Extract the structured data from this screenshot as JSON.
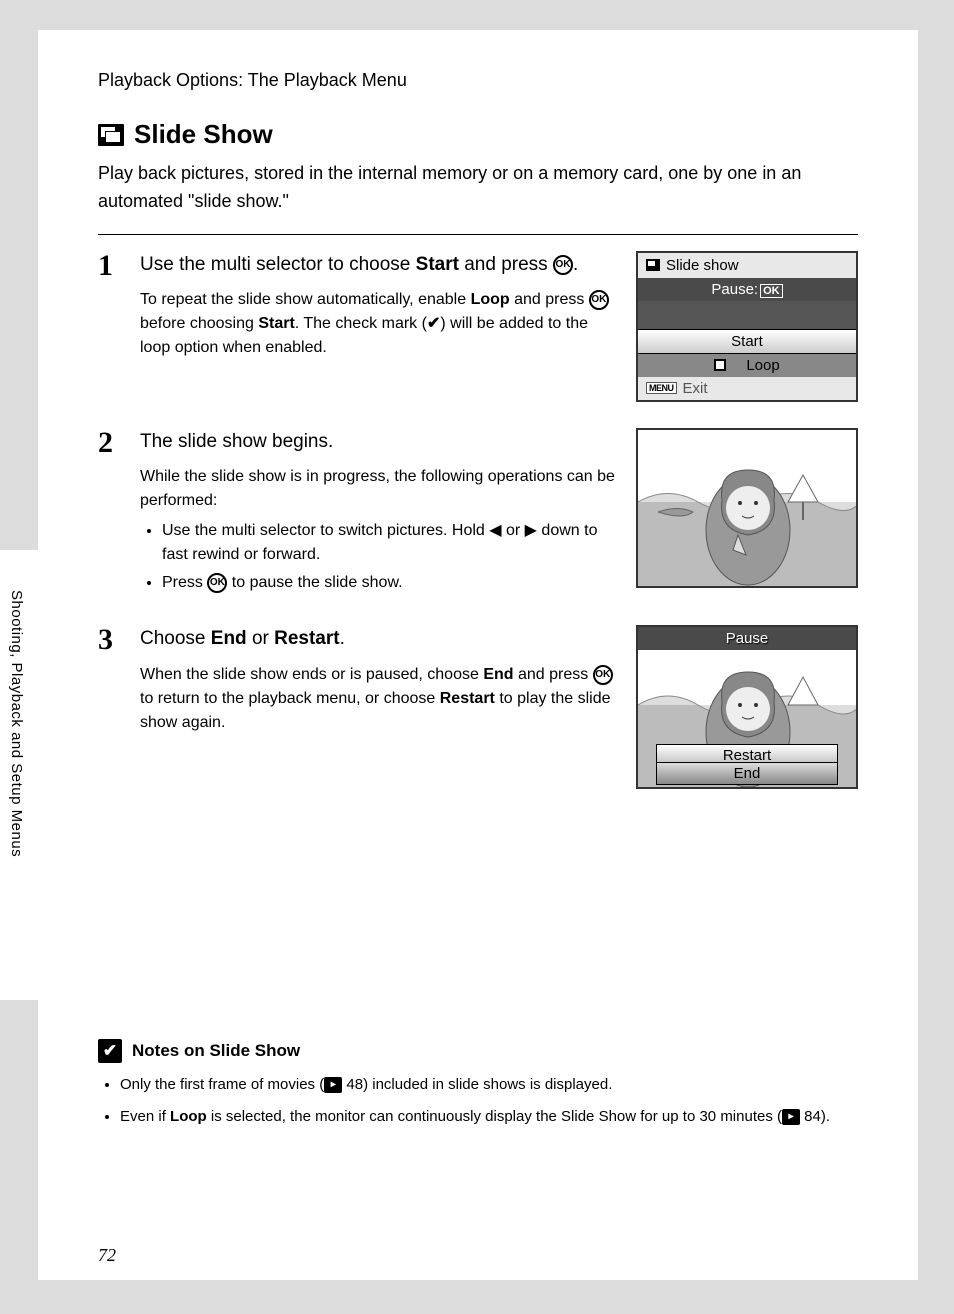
{
  "side_tab": "Shooting, Playback and Setup Menus",
  "chapter": "Playback Options: The Playback Menu",
  "heading": "Slide Show",
  "intro": "Play back pictures, stored in the internal memory or on a memory card, one by one in an automated \"slide show.\"",
  "step1": {
    "title_a": "Use the multi selector to choose ",
    "title_b": "Start",
    "title_c": " and press ",
    "body_a": "To repeat the slide show automatically, enable ",
    "body_b": "Loop",
    "body_c": " and press ",
    "body_d": " before choosing ",
    "body_e": "Start",
    "body_f": ". The check mark (",
    "body_g": ") will be added to the loop option when enabled."
  },
  "step2": {
    "title": "The slide show begins.",
    "p": "While the slide show is in progress, the following operations can be performed:",
    "li1_a": "Use the multi selector to switch pictures. Hold ",
    "li1_b": " or ",
    "li1_c": " down to fast rewind or forward.",
    "li2_a": "Press ",
    "li2_b": " to pause the slide show."
  },
  "step3": {
    "title_a": "Choose ",
    "title_b": "End",
    "title_c": " or ",
    "title_d": "Restart",
    "title_e": ".",
    "body_a": "When the slide show ends or is paused, choose ",
    "body_b": "End",
    "body_c": " and press ",
    "body_d": " to return to the playback menu, or choose ",
    "body_e": "Restart",
    "body_f": " to play the slide show again."
  },
  "screen1": {
    "title": "Slide show",
    "pause": "Pause:",
    "ok": "OK",
    "start": "Start",
    "loop": "Loop",
    "menu": "MENU",
    "exit": "Exit"
  },
  "screen3": {
    "pause": "Pause",
    "restart": "Restart",
    "end": "End"
  },
  "notes": {
    "heading": "Notes on Slide Show",
    "li1_a": "Only the first frame of movies (",
    "li1_b": " 48) included in slide shows is displayed.",
    "li2_a": "Even if ",
    "li2_b": "Loop",
    "li2_c": " is selected, the monitor can continuously display the Slide Show for up to 30 minutes (",
    "li2_d": " 84)."
  },
  "page_number": "72"
}
